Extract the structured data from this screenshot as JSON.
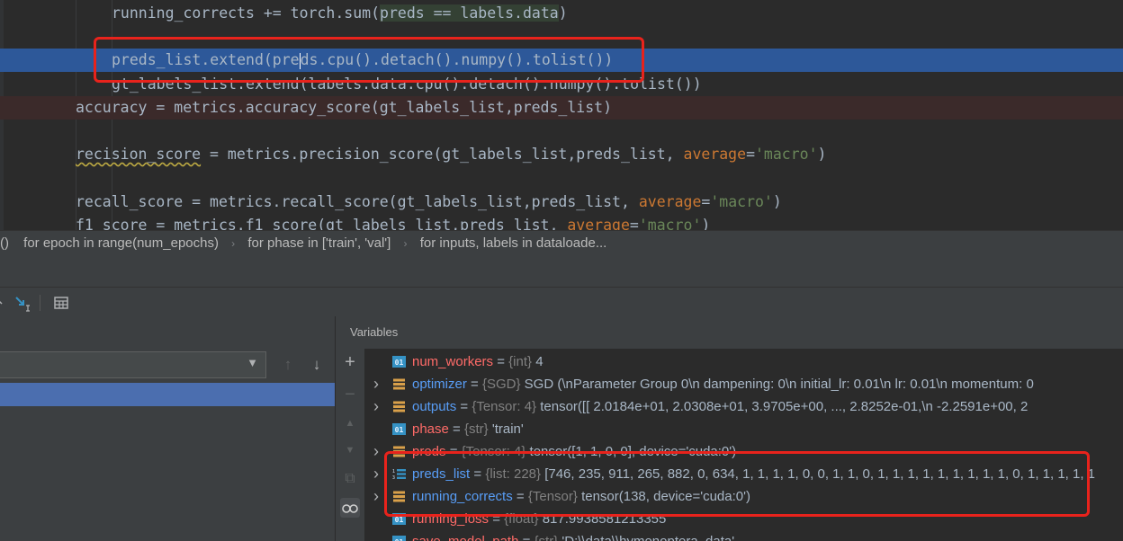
{
  "editor": {
    "lines": [
      {
        "seg": [
          "running_corrects += torch.sum(",
          "preds == labels.data",
          ")"
        ]
      },
      {
        "text": ""
      },
      {
        "seg": [
          "preds_list.extend(pre",
          "ds.cpu().detach().numpy().tolist())"
        ]
      },
      {
        "text": "gt_labels_list.extend(labels.data.cpu().detach().numpy().tolist())"
      },
      {
        "text": "accuracy = metrics.accuracy_score(gt_labels_list,preds_list)"
      },
      {
        "text": ""
      },
      {
        "seg": [
          "recision_score",
          " = metrics.precision_score(gt_labels_list,preds_list, ",
          "average",
          "=",
          "'macro'",
          ")"
        ]
      },
      {
        "text": ""
      },
      {
        "seg": [
          "recall_score = metrics.recall_score(gt_labels_list,preds_list, ",
          "average",
          "=",
          "'macro'",
          ")"
        ]
      },
      {
        "seg": [
          "f1_score = metrics.f1_score(gt_labels_list,preds_list, ",
          "average",
          "=",
          "'macro'",
          ")"
        ]
      }
    ]
  },
  "breadcrumb": {
    "items": [
      "()",
      "for epoch in range(num_epochs)",
      "for phase in ['train', 'val']",
      "for inputs, labels in dataloade..."
    ],
    "separator": "›"
  },
  "toolbar": {
    "icons": [
      "step-out-icon",
      "run-to-cursor-icon",
      "evaluate-expression-icon"
    ]
  },
  "frames": {
    "up_arrow": "↑",
    "down_arrow": "↓"
  },
  "variables": {
    "header": "Variables",
    "tools": {
      "add": "+",
      "remove": "−",
      "up": "▲",
      "down": "▼",
      "copy": "⧉",
      "watch": "👓"
    },
    "rows": [
      {
        "name": "num_workers",
        "type": "{int}",
        "value": "4",
        "icon": "01",
        "expandable": false
      },
      {
        "name": "optimizer",
        "type": "{SGD}",
        "value": "SGD (\\nParameter Group 0\\n    dampening: 0\\n    initial_lr: 0.01\\n    lr: 0.01\\n    momentum: 0",
        "icon": "obj",
        "expandable": true
      },
      {
        "name": "outputs",
        "type": "{Tensor: 4}",
        "value": "tensor([[ 2.0184e+01,  2.0308e+01,  3.9705e+00,  ...,  2.8252e-01,\\n        -2.2591e+00,  2",
        "icon": "obj",
        "expandable": true
      },
      {
        "name": "phase",
        "type": "{str}",
        "value": "'train'",
        "icon": "01",
        "expandable": false
      },
      {
        "name": "preds",
        "type": "{Tensor: 4}",
        "value": "tensor([1, 1, 0, 0], device='cuda:0')",
        "icon": "obj",
        "expandable": true
      },
      {
        "name": "preds_list",
        "type": "{list: 228}",
        "value": "[746, 235, 911, 265, 882, 0, 634, 1, 1, 1, 1, 0, 0, 1, 1, 0, 1, 1, 1, 1, 1, 1, 1, 1, 1, 0, 1, 1, 1, 1, 1",
        "icon": "list",
        "expandable": true
      },
      {
        "name": "running_corrects",
        "type": "{Tensor}",
        "value": "tensor(138, device='cuda:0')",
        "icon": "obj",
        "expandable": true
      },
      {
        "name": "running_loss",
        "type": "{float}",
        "value": "817.9938581213355",
        "icon": "01",
        "expandable": false
      },
      {
        "name": "save_model_path",
        "type": "{str}",
        "value": "'D:\\\\data\\\\hymenoptera_data'",
        "icon": "01",
        "expandable": false
      }
    ]
  },
  "colors": {
    "annotation_red": "#e8231c",
    "exec_line_blue": "#2d5899",
    "var_name_red": "#ff6b68",
    "var_name_blue": "#589df6"
  }
}
